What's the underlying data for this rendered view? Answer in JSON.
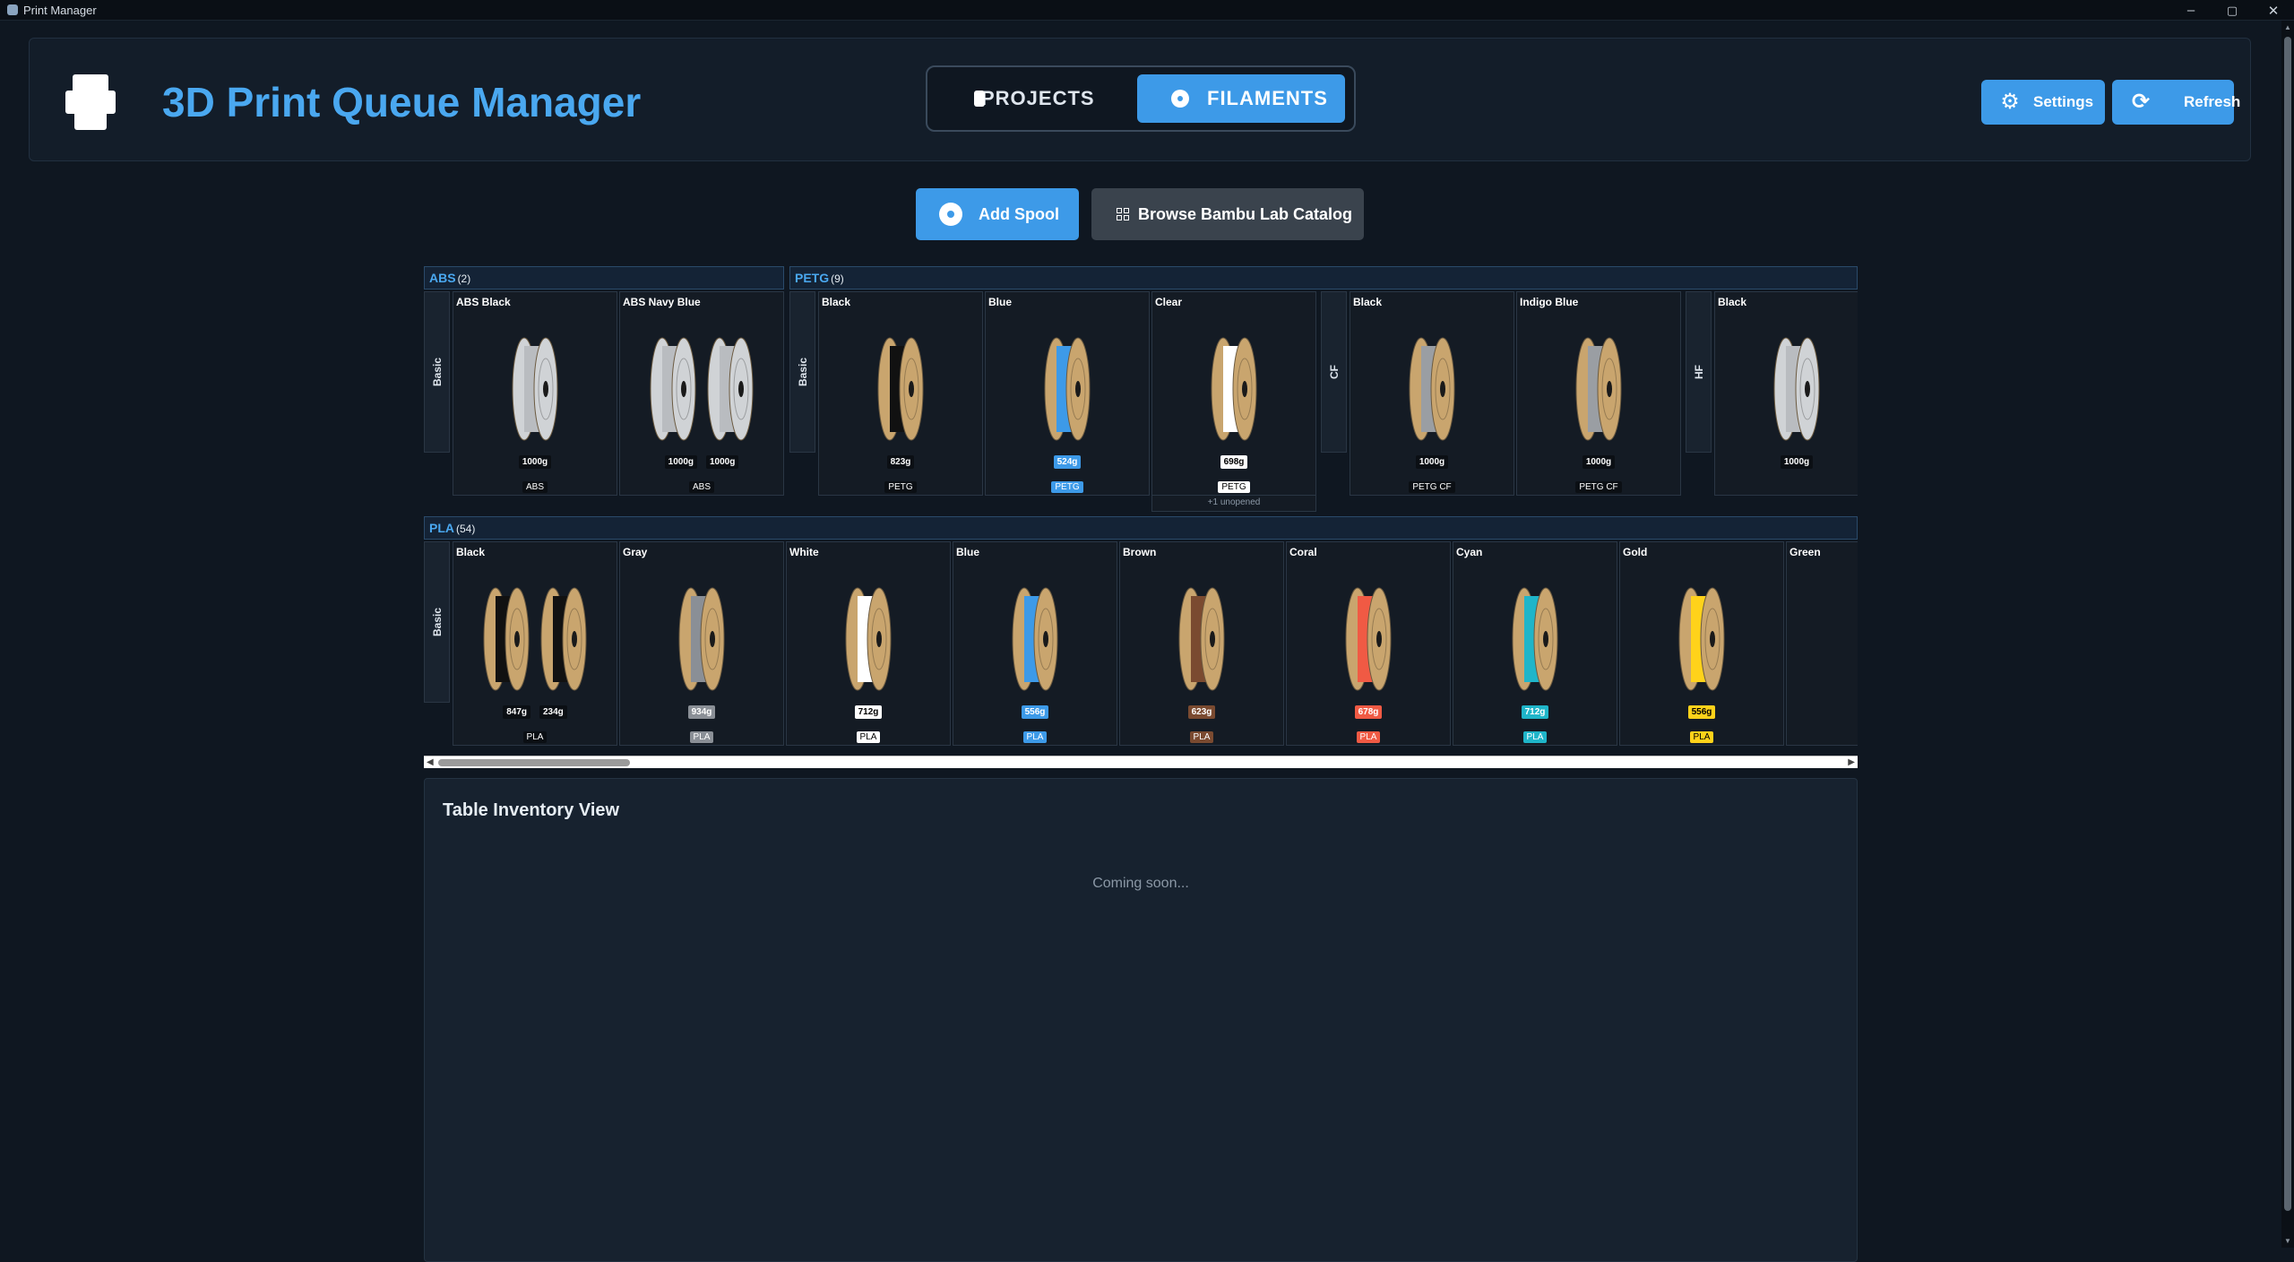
{
  "window": {
    "title": "Print Manager",
    "controls": [
      "–",
      "▢",
      "✕"
    ]
  },
  "header": {
    "title": "3D Print Queue Manager",
    "tabs": [
      {
        "label": "PROJECTS",
        "active": false
      },
      {
        "label": "FILAMENTS",
        "active": true
      }
    ],
    "settings_label": "Settings",
    "refresh_label": "Refresh"
  },
  "actions": {
    "add_spool_label": "Add Spool",
    "catalog_label": "Browse Bambu Lab Catalog"
  },
  "colors": {
    "accent": "#3d9ae8",
    "spool_wood": "#c9a56e"
  },
  "groups": [
    {
      "name": "ABS",
      "count": "(2)",
      "subgroups": [
        {
          "label": "Basic",
          "cards": [
            {
              "name": "ABS Black",
              "spools": [
                {
                  "filament": "#b9bcc0",
                  "reel": "#d0d3d6",
                  "weight": "1000g",
                  "badge": "#0b0f14"
                }
              ],
              "material": "ABS",
              "mat_bg": "#0b0f14"
            },
            {
              "name": "ABS Navy Blue",
              "spools": [
                {
                  "filament": "#b9bcc0",
                  "reel": "#d0d3d6",
                  "weight": "1000g",
                  "badge": "#0b0f14"
                },
                {
                  "filament": "#b9bcc0",
                  "reel": "#d0d3d6",
                  "weight": "1000g",
                  "badge": "#0b0f14"
                }
              ],
              "material": "ABS",
              "mat_bg": "#0b0f14"
            }
          ]
        }
      ]
    },
    {
      "name": "PETG",
      "count": "(9)",
      "subgroups": [
        {
          "label": "Basic",
          "cards": [
            {
              "name": "Black",
              "spools": [
                {
                  "filament": "#111111",
                  "reel": "#c9a56e",
                  "weight": "823g",
                  "badge": "#0b0f14"
                }
              ],
              "material": "PETG",
              "mat_bg": "#0b0f14"
            },
            {
              "name": "Blue",
              "spools": [
                {
                  "filament": "#3d9ae8",
                  "reel": "#c9a56e",
                  "weight": "524g",
                  "badge": "#3d9ae8"
                }
              ],
              "material": "PETG",
              "mat_bg": "#3d9ae8"
            },
            {
              "name": "Clear",
              "spools": [
                {
                  "filament": "#ffffff",
                  "reel": "#c9a56e",
                  "weight": "698g",
                  "badge": "#ffffff",
                  "badge_text": "#000000"
                }
              ],
              "material": "PETG",
              "mat_bg": "#ffffff",
              "mat_text": "#000000",
              "note": "+1 unopened"
            }
          ]
        },
        {
          "label": "CF",
          "cards": [
            {
              "name": "Black",
              "spools": [
                {
                  "filament": "#9a9ea3",
                  "reel": "#c9a56e",
                  "weight": "1000g",
                  "badge": "#0b0f14"
                }
              ],
              "material": "PETG CF",
              "mat_bg": "#0b0f14"
            },
            {
              "name": "Indigo Blue",
              "spools": [
                {
                  "filament": "#9a9ea3",
                  "reel": "#c9a56e",
                  "weight": "1000g",
                  "badge": "#0b0f14"
                }
              ],
              "material": "PETG CF",
              "mat_bg": "#0b0f14"
            }
          ]
        },
        {
          "label": "HF",
          "cards": [
            {
              "name": "Black",
              "spools": [
                {
                  "filament": "#b9bcc0",
                  "reel": "#d0d3d6",
                  "weight": "1000g",
                  "badge": "#0b0f14"
                }
              ],
              "material": "",
              "mat_bg": "#0b0f14"
            }
          ]
        }
      ]
    },
    {
      "name": "PLA",
      "count": "(54)",
      "subgroups": [
        {
          "label": "Basic",
          "cards": [
            {
              "name": "Black",
              "spools": [
                {
                  "filament": "#111111",
                  "reel": "#c9a56e",
                  "weight": "847g",
                  "badge": "#0b0f14"
                },
                {
                  "filament": "#111111",
                  "reel": "#c9a56e",
                  "weight": "234g",
                  "badge": "#0b0f14"
                }
              ],
              "material": "PLA",
              "mat_bg": "#0b0f14"
            },
            {
              "name": "Gray",
              "spools": [
                {
                  "filament": "#8a8f96",
                  "reel": "#c9a56e",
                  "weight": "934g",
                  "badge": "#8a8f96"
                }
              ],
              "material": "PLA",
              "mat_bg": "#8a8f96"
            },
            {
              "name": "White",
              "spools": [
                {
                  "filament": "#ffffff",
                  "reel": "#c9a56e",
                  "weight": "712g",
                  "badge": "#ffffff",
                  "badge_text": "#000000"
                }
              ],
              "material": "PLA",
              "mat_bg": "#ffffff",
              "mat_text": "#000000"
            },
            {
              "name": "Blue",
              "spools": [
                {
                  "filament": "#3d9ae8",
                  "reel": "#c9a56e",
                  "weight": "556g",
                  "badge": "#3d9ae8"
                }
              ],
              "material": "PLA",
              "mat_bg": "#3d9ae8"
            },
            {
              "name": "Brown",
              "spools": [
                {
                  "filament": "#7a4a30",
                  "reel": "#c9a56e",
                  "weight": "623g",
                  "badge": "#7a4a30"
                }
              ],
              "material": "PLA",
              "mat_bg": "#7a4a30"
            },
            {
              "name": "Coral",
              "spools": [
                {
                  "filament": "#f05a44",
                  "reel": "#c9a56e",
                  "weight": "678g",
                  "badge": "#f05a44"
                }
              ],
              "material": "PLA",
              "mat_bg": "#f05a44"
            },
            {
              "name": "Cyan",
              "spools": [
                {
                  "filament": "#1fb5c9",
                  "reel": "#c9a56e",
                  "weight": "712g",
                  "badge": "#1fb5c9"
                }
              ],
              "material": "PLA",
              "mat_bg": "#1fb5c9"
            },
            {
              "name": "Gold",
              "spools": [
                {
                  "filament": "#ffd21a",
                  "reel": "#c9a56e",
                  "weight": "556g",
                  "badge": "#ffd21a",
                  "badge_text": "#000000"
                }
              ],
              "material": "PLA",
              "mat_bg": "#ffd21a",
              "mat_text": "#000000"
            },
            {
              "name": "Green",
              "spools": [],
              "material": "",
              "mat_bg": "#0b0f14"
            }
          ]
        }
      ]
    }
  ],
  "table_view": {
    "title": "Table Inventory View",
    "placeholder": "Coming soon..."
  }
}
